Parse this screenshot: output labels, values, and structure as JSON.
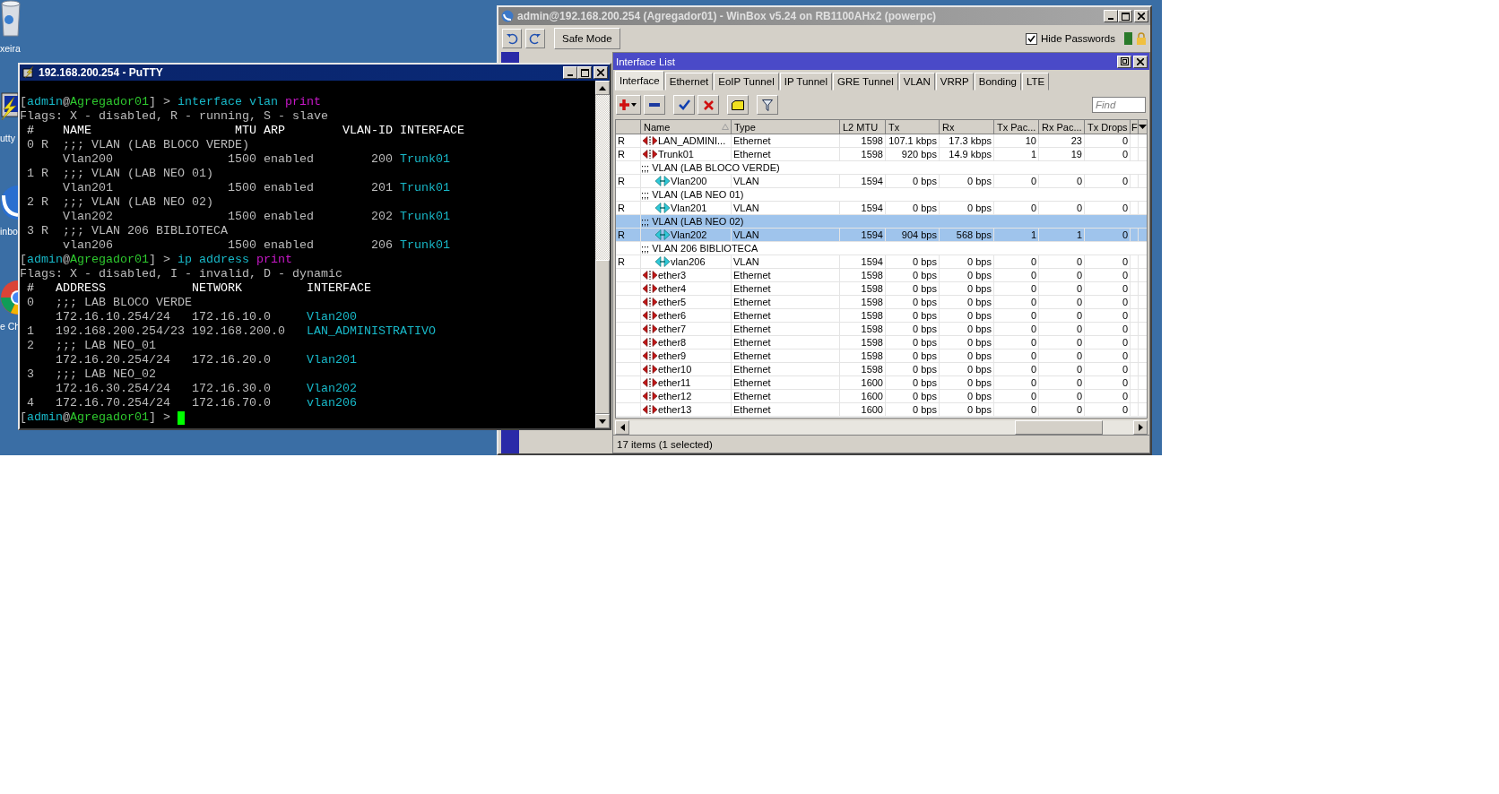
{
  "desktop": {
    "icons": [
      {
        "kind": "trash",
        "label": "xeira"
      },
      {
        "kind": "terminal",
        "label": "utty"
      },
      {
        "kind": "winbox",
        "label": "inbo"
      },
      {
        "kind": "browser",
        "label": "e Ch"
      }
    ]
  },
  "putty": {
    "title": "192.168.200.254 - PuTTY",
    "lines": [
      {
        "segments": [
          {
            "text": "[",
            "kind": "plain"
          },
          {
            "text": "admin",
            "kind": "cyan"
          },
          {
            "text": "@",
            "kind": "plain"
          },
          {
            "text": "Agregador01",
            "kind": "green"
          },
          {
            "text": "] > ",
            "kind": "plain"
          },
          {
            "text": "interface vlan ",
            "kind": "cyan"
          },
          {
            "text": "print",
            "kind": "magenta"
          }
        ]
      },
      {
        "segments": [
          {
            "text": "Flags: X - disabled, R - running, S - slave",
            "kind": "plain"
          }
        ]
      },
      {
        "segments": [
          {
            "text": " #    NAME                    MTU ARP        VLAN-ID INTERFACE",
            "kind": "bright"
          }
        ]
      },
      {
        "segments": [
          {
            "text": " 0 R  ;;; VLAN (LAB BLOCO VERDE)",
            "kind": "plain"
          }
        ]
      },
      {
        "segments": [
          {
            "text": "      Vlan200                1500 enabled        200 ",
            "kind": "plain"
          },
          {
            "text": "Trunk01",
            "kind": "cyan"
          }
        ]
      },
      {
        "segments": [
          {
            "text": " 1 R  ;;; VLAN (LAB NEO 01)",
            "kind": "plain"
          }
        ]
      },
      {
        "segments": [
          {
            "text": "      Vlan201                1500 enabled        201 ",
            "kind": "plain"
          },
          {
            "text": "Trunk01",
            "kind": "cyan"
          }
        ]
      },
      {
        "segments": [
          {
            "text": " 2 R  ;;; VLAN (LAB NEO 02)",
            "kind": "plain"
          }
        ]
      },
      {
        "segments": [
          {
            "text": "      Vlan202                1500 enabled        202 ",
            "kind": "plain"
          },
          {
            "text": "Trunk01",
            "kind": "cyan"
          }
        ]
      },
      {
        "segments": [
          {
            "text": " 3 R  ;;; VLAN 206 BIBLIOTECA",
            "kind": "plain"
          }
        ]
      },
      {
        "segments": [
          {
            "text": "      vlan206                1500 enabled        206 ",
            "kind": "plain"
          },
          {
            "text": "Trunk01",
            "kind": "cyan"
          }
        ]
      },
      {
        "segments": [
          {
            "text": "[",
            "kind": "plain"
          },
          {
            "text": "admin",
            "kind": "cyan"
          },
          {
            "text": "@",
            "kind": "plain"
          },
          {
            "text": "Agregador01",
            "kind": "green"
          },
          {
            "text": "] > ",
            "kind": "plain"
          },
          {
            "text": "ip address ",
            "kind": "cyan"
          },
          {
            "text": "print",
            "kind": "magenta"
          }
        ]
      },
      {
        "segments": [
          {
            "text": "Flags: X - disabled, I - invalid, D - dynamic",
            "kind": "plain"
          }
        ]
      },
      {
        "segments": [
          {
            "text": " #   ADDRESS            NETWORK         INTERFACE",
            "kind": "bright"
          }
        ]
      },
      {
        "segments": [
          {
            "text": " 0   ;;; LAB BLOCO VERDE",
            "kind": "plain"
          }
        ]
      },
      {
        "segments": [
          {
            "text": "     172.16.10.254/24   172.16.10.0     ",
            "kind": "plain"
          },
          {
            "text": "Vlan200",
            "kind": "cyan"
          }
        ]
      },
      {
        "segments": [
          {
            "text": " 1   192.168.200.254/23 192.168.200.0   ",
            "kind": "plain"
          },
          {
            "text": "LAN_ADMINISTRATIVO",
            "kind": "cyan"
          }
        ]
      },
      {
        "segments": [
          {
            "text": " 2   ;;; LAB NEO_01",
            "kind": "plain"
          }
        ]
      },
      {
        "segments": [
          {
            "text": "     172.16.20.254/24   172.16.20.0     ",
            "kind": "plain"
          },
          {
            "text": "Vlan201",
            "kind": "cyan"
          }
        ]
      },
      {
        "segments": [
          {
            "text": " 3   ;;; LAB NEO_02",
            "kind": "plain"
          }
        ]
      },
      {
        "segments": [
          {
            "text": "     172.16.30.254/24   172.16.30.0     ",
            "kind": "plain"
          },
          {
            "text": "Vlan202",
            "kind": "cyan"
          }
        ]
      },
      {
        "segments": [
          {
            "text": " 4   172.16.70.254/24   172.16.70.0     ",
            "kind": "plain"
          },
          {
            "text": "vlan206",
            "kind": "cyan"
          }
        ]
      },
      {
        "segments": [
          {
            "text": "[",
            "kind": "plain"
          },
          {
            "text": "admin",
            "kind": "cyan"
          },
          {
            "text": "@",
            "kind": "plain"
          },
          {
            "text": "Agregador01",
            "kind": "green"
          },
          {
            "text": "] > ",
            "kind": "plain"
          }
        ],
        "cursor": true
      }
    ]
  },
  "winbox": {
    "title": "admin@192.168.200.254 (Agregador01) - WinBox v5.24 on RB1100AHx2 (powerpc)",
    "safe_mode": "Safe Mode",
    "hide_passwords": {
      "label": "Hide Passwords",
      "checked": true
    },
    "interface_list": {
      "title": "Interface List",
      "tabs": [
        {
          "label": "Interface",
          "selected": true
        },
        {
          "label": "Ethernet",
          "selected": false
        },
        {
          "label": "EoIP Tunnel",
          "selected": false
        },
        {
          "label": "IP Tunnel",
          "selected": false
        },
        {
          "label": "GRE Tunnel",
          "selected": false
        },
        {
          "label": "VLAN",
          "selected": false
        },
        {
          "label": "VRRP",
          "selected": false
        },
        {
          "label": "Bonding",
          "selected": false
        },
        {
          "label": "LTE",
          "selected": false
        }
      ],
      "find": {
        "placeholder": "Find"
      },
      "table": {
        "columns": [
          {
            "label": "Name",
            "sorted": true
          },
          {
            "label": "Type",
            "sorted": false
          },
          {
            "label": "L2 MTU",
            "sorted": false
          },
          {
            "label": "Tx",
            "sorted": false
          },
          {
            "label": "Rx",
            "sorted": false
          },
          {
            "label": "Tx Pac...",
            "sorted": false
          },
          {
            "label": "Rx Pac...",
            "sorted": false
          },
          {
            "label": "Tx Drops",
            "sorted": false
          },
          {
            "label": "F",
            "sorted": false
          }
        ],
        "rows": [
          {
            "kind": "ethernet",
            "selected": false,
            "flag": "R",
            "name": "LAN_ADMINI...",
            "type": "Ethernet",
            "l2_mtu": "1598",
            "tx": "107.1 kbps",
            "rx": "17.3 kbps",
            "tx_packets": "10",
            "rx_packets": "23",
            "tx_drops": "0"
          },
          {
            "kind": "ethernet",
            "selected": false,
            "flag": "R",
            "name": "Trunk01",
            "type": "Ethernet",
            "l2_mtu": "1598",
            "tx": "920 bps",
            "rx": "14.9 kbps",
            "tx_packets": "1",
            "rx_packets": "19",
            "tx_drops": "0"
          },
          {
            "kind": "comment",
            "selected": false,
            "text": ";;; VLAN (LAB BLOCO VERDE)",
            "children": [
              {
                "kind": "vlan",
                "selected": false,
                "flag": "R",
                "name": "Vlan200",
                "type": "VLAN",
                "l2_mtu": "1594",
                "tx": "0 bps",
                "rx": "0 bps",
                "tx_packets": "0",
                "rx_packets": "0",
                "tx_drops": "0"
              }
            ]
          },
          {
            "kind": "comment",
            "selected": false,
            "text": ";;; VLAN (LAB NEO 01)",
            "children": [
              {
                "kind": "vlan",
                "selected": false,
                "flag": "R",
                "name": "Vlan201",
                "type": "VLAN",
                "l2_mtu": "1594",
                "tx": "0 bps",
                "rx": "0 bps",
                "tx_packets": "0",
                "rx_packets": "0",
                "tx_drops": "0"
              }
            ]
          },
          {
            "kind": "comment",
            "selected": true,
            "text": ";;; VLAN (LAB NEO 02)",
            "children": [
              {
                "kind": "vlan",
                "selected": true,
                "flag": "R",
                "name": "Vlan202",
                "type": "VLAN",
                "l2_mtu": "1594",
                "tx": "904 bps",
                "rx": "568 bps",
                "tx_packets": "1",
                "rx_packets": "1",
                "tx_drops": "0"
              }
            ]
          },
          {
            "kind": "comment",
            "selected": false,
            "text": ";;; VLAN 206 BIBLIOTECA",
            "children": [
              {
                "kind": "vlan",
                "selected": false,
                "flag": "R",
                "name": "vlan206",
                "type": "VLAN",
                "l2_mtu": "1594",
                "tx": "0 bps",
                "rx": "0 bps",
                "tx_packets": "0",
                "rx_packets": "0",
                "tx_drops": "0"
              }
            ]
          },
          {
            "kind": "ethernet",
            "selected": false,
            "name": "ether3",
            "type": "Ethernet",
            "l2_mtu": "1598",
            "tx": "0 bps",
            "rx": "0 bps",
            "tx_packets": "0",
            "rx_packets": "0",
            "tx_drops": "0"
          },
          {
            "kind": "ethernet",
            "selected": false,
            "name": "ether4",
            "type": "Ethernet",
            "l2_mtu": "1598",
            "tx": "0 bps",
            "rx": "0 bps",
            "tx_packets": "0",
            "rx_packets": "0",
            "tx_drops": "0"
          },
          {
            "kind": "ethernet",
            "selected": false,
            "name": "ether5",
            "type": "Ethernet",
            "l2_mtu": "1598",
            "tx": "0 bps",
            "rx": "0 bps",
            "tx_packets": "0",
            "rx_packets": "0",
            "tx_drops": "0"
          },
          {
            "kind": "ethernet",
            "selected": false,
            "name": "ether6",
            "type": "Ethernet",
            "l2_mtu": "1598",
            "tx": "0 bps",
            "rx": "0 bps",
            "tx_packets": "0",
            "rx_packets": "0",
            "tx_drops": "0"
          },
          {
            "kind": "ethernet",
            "selected": false,
            "name": "ether7",
            "type": "Ethernet",
            "l2_mtu": "1598",
            "tx": "0 bps",
            "rx": "0 bps",
            "tx_packets": "0",
            "rx_packets": "0",
            "tx_drops": "0"
          },
          {
            "kind": "ethernet",
            "selected": false,
            "name": "ether8",
            "type": "Ethernet",
            "l2_mtu": "1598",
            "tx": "0 bps",
            "rx": "0 bps",
            "tx_packets": "0",
            "rx_packets": "0",
            "tx_drops": "0"
          },
          {
            "kind": "ethernet",
            "selected": false,
            "name": "ether9",
            "type": "Ethernet",
            "l2_mtu": "1598",
            "tx": "0 bps",
            "rx": "0 bps",
            "tx_packets": "0",
            "rx_packets": "0",
            "tx_drops": "0"
          },
          {
            "kind": "ethernet",
            "selected": false,
            "name": "ether10",
            "type": "Ethernet",
            "l2_mtu": "1598",
            "tx": "0 bps",
            "rx": "0 bps",
            "tx_packets": "0",
            "rx_packets": "0",
            "tx_drops": "0"
          },
          {
            "kind": "ethernet",
            "selected": false,
            "name": "ether11",
            "type": "Ethernet",
            "l2_mtu": "1600",
            "tx": "0 bps",
            "rx": "0 bps",
            "tx_packets": "0",
            "rx_packets": "0",
            "tx_drops": "0"
          },
          {
            "kind": "ethernet",
            "selected": false,
            "name": "ether12",
            "type": "Ethernet",
            "l2_mtu": "1600",
            "tx": "0 bps",
            "rx": "0 bps",
            "tx_packets": "0",
            "rx_packets": "0",
            "tx_drops": "0"
          },
          {
            "kind": "ethernet",
            "selected": false,
            "name": "ether13",
            "type": "Ethernet",
            "l2_mtu": "1600",
            "tx": "0 bps",
            "rx": "0 bps",
            "tx_packets": "0",
            "rx_packets": "0",
            "tx_drops": "0"
          }
        ]
      },
      "status": "17 items (1 selected)"
    }
  }
}
